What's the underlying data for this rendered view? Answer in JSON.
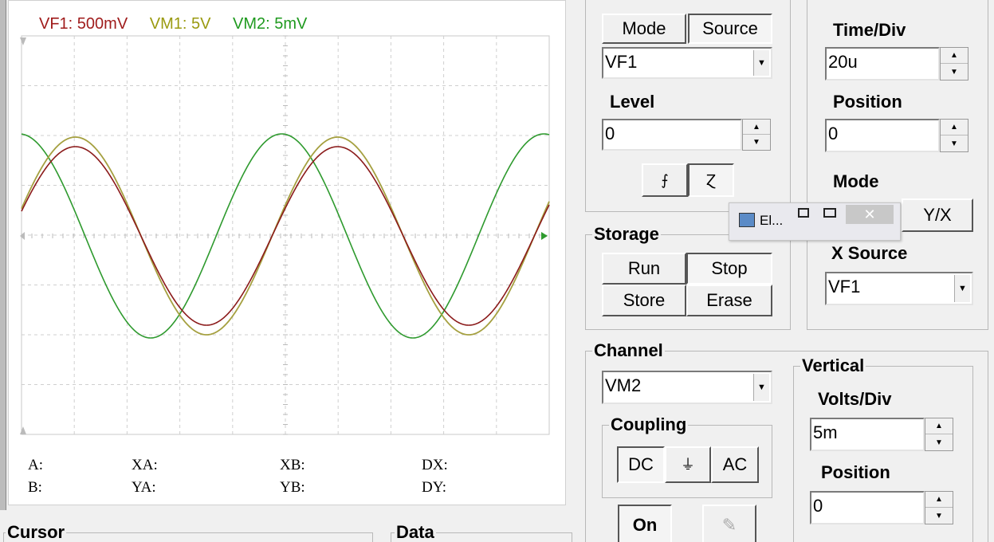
{
  "scope": {
    "channel_labels": [
      {
        "text": "VF1: 500mV",
        "color": "#a01c1c"
      },
      {
        "text": "VM1: 5V",
        "color": "#9a9a10"
      },
      {
        "text": "VM2: 5mV",
        "color": "#1f9a1f"
      }
    ],
    "readouts": {
      "a": "A:",
      "b": "B:",
      "xa": "XA:",
      "ya": "YA:",
      "xb": "XB:",
      "yb": "YB:",
      "dx": "DX:",
      "dy": "DY:"
    }
  },
  "trigger": {
    "mode_label": "Mode",
    "source_label": "Source",
    "source_value": "VF1",
    "level_label": "Level",
    "level_value": "0"
  },
  "horizontal": {
    "time_div_label": "Time/Div",
    "time_div_value": "20u",
    "position_label": "Position",
    "position_value": "0",
    "mode_label": "Mode",
    "yx_label": "Y/X",
    "xsource_label": "X Source",
    "xsource_value": "VF1"
  },
  "storage": {
    "title": "Storage",
    "run": "Run",
    "stop": "Stop",
    "store": "Store",
    "erase": "Erase"
  },
  "channel": {
    "title": "Channel",
    "value": "VM2",
    "coupling_title": "Coupling",
    "dc": "DC",
    "gnd": "⏚",
    "ac": "AC",
    "on": "On"
  },
  "vertical": {
    "title": "Vertical",
    "volts_div_label": "Volts/Div",
    "volts_div_value": "5m",
    "position_label": "Position",
    "position_value": "0"
  },
  "bottom": {
    "cursor_title": "Cursor",
    "data_title": "Data"
  },
  "mini_window": {
    "title": "El...",
    "close": "✕"
  },
  "colors": {
    "vf1": "#8b1a1a",
    "vm1": "#a5a040",
    "vm2": "#2e9a2e"
  }
}
